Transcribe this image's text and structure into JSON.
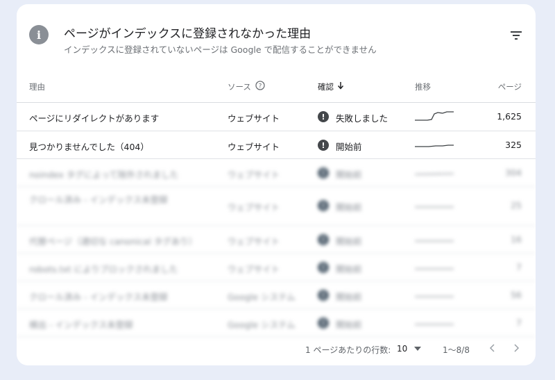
{
  "header": {
    "title": "ページがインデックスに登録されなかった理由",
    "subtitle": "インデックスに登録されていないページは Google で配信することができません"
  },
  "columns": {
    "reason": "理由",
    "source": "ソース",
    "check": "確認",
    "trend": "推移",
    "pages": "ページ"
  },
  "rows": [
    {
      "reason": "ページにリダイレクトがあります",
      "source": "ウェブサイト",
      "status": "失敗しました",
      "pages": "1,625"
    },
    {
      "reason": "見つかりませんでした（404）",
      "source": "ウェブサイト",
      "status": "開始前",
      "pages": "325"
    },
    {
      "reason": "noindex タグによって除外されました",
      "source": "ウェブサイト",
      "status": "開始前",
      "pages": "304"
    },
    {
      "reason": "クロール済み - インデックス未登録",
      "source": "ウェブサイト",
      "status": "開始前",
      "pages": "25"
    },
    {
      "reason": "代替ページ（適切な canonical タグあり）",
      "source": "ウェブサイト",
      "status": "開始前",
      "pages": "16"
    },
    {
      "reason": "robots.txt によりブロックされました",
      "source": "ウェブサイト",
      "status": "開始前",
      "pages": "7"
    },
    {
      "reason": "クロール済み - インデックス未登録",
      "source": "Google システム",
      "status": "開始前",
      "pages": "56"
    },
    {
      "reason": "検出 - インデックス未登録",
      "source": "Google システム",
      "status": "開始前",
      "pages": "7"
    }
  ],
  "footer": {
    "rows_per_page_label": "1 ページあたりの行数:",
    "rows_per_page_value": "10",
    "range": "1〜8/8"
  },
  "icons": {
    "info": "info-icon",
    "filter": "filter-icon",
    "help": "help-icon",
    "sort": "arrow-down-icon",
    "status": "error-icon"
  },
  "colors": {
    "background": "#e8edf8",
    "card": "#ffffff",
    "status_icon": "#44474b"
  }
}
